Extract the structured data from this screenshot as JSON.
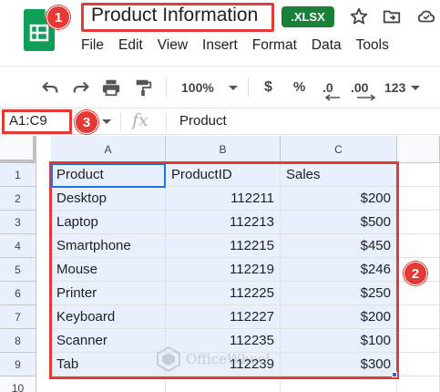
{
  "header": {
    "title": "Product Information",
    "file_badge": ".XLSX",
    "menu": [
      "File",
      "Edit",
      "View",
      "Insert",
      "Format",
      "Data",
      "Tools"
    ]
  },
  "toolbar": {
    "zoom": "100%",
    "currency": "$",
    "percent": "%",
    "decrease_decimal": ".0",
    "increase_decimal": ".00",
    "more_formats": "123"
  },
  "formula_bar": {
    "name_box": "A1:C9",
    "fx": "fx",
    "content": "Product"
  },
  "annotations": [
    "1",
    "2",
    "3"
  ],
  "sheet": {
    "columns": [
      "A",
      "B",
      "C"
    ],
    "rows": [
      "1",
      "2",
      "3",
      "4",
      "5",
      "6",
      "7",
      "8",
      "9",
      "10"
    ],
    "headers": [
      "Product",
      "ProductID",
      "Sales"
    ],
    "data": [
      [
        "Desktop",
        "112211",
        "$200"
      ],
      [
        "Laptop",
        "112213",
        "$500"
      ],
      [
        "Smartphone",
        "112215",
        "$450"
      ],
      [
        "Mouse",
        "112219",
        "$246"
      ],
      [
        "Printer",
        "112225",
        "$250"
      ],
      [
        "Keyboard",
        "112227",
        "$200"
      ],
      [
        "Scanner",
        "112235",
        "$100"
      ],
      [
        "Tab",
        "112239",
        "$300"
      ]
    ]
  },
  "watermark": "OfficeWheel",
  "colors": {
    "annotation_red": "#e53935",
    "selection_blue": "#1a73e8",
    "selection_fill": "#e8f0fe",
    "xlsx_green": "#188038"
  }
}
